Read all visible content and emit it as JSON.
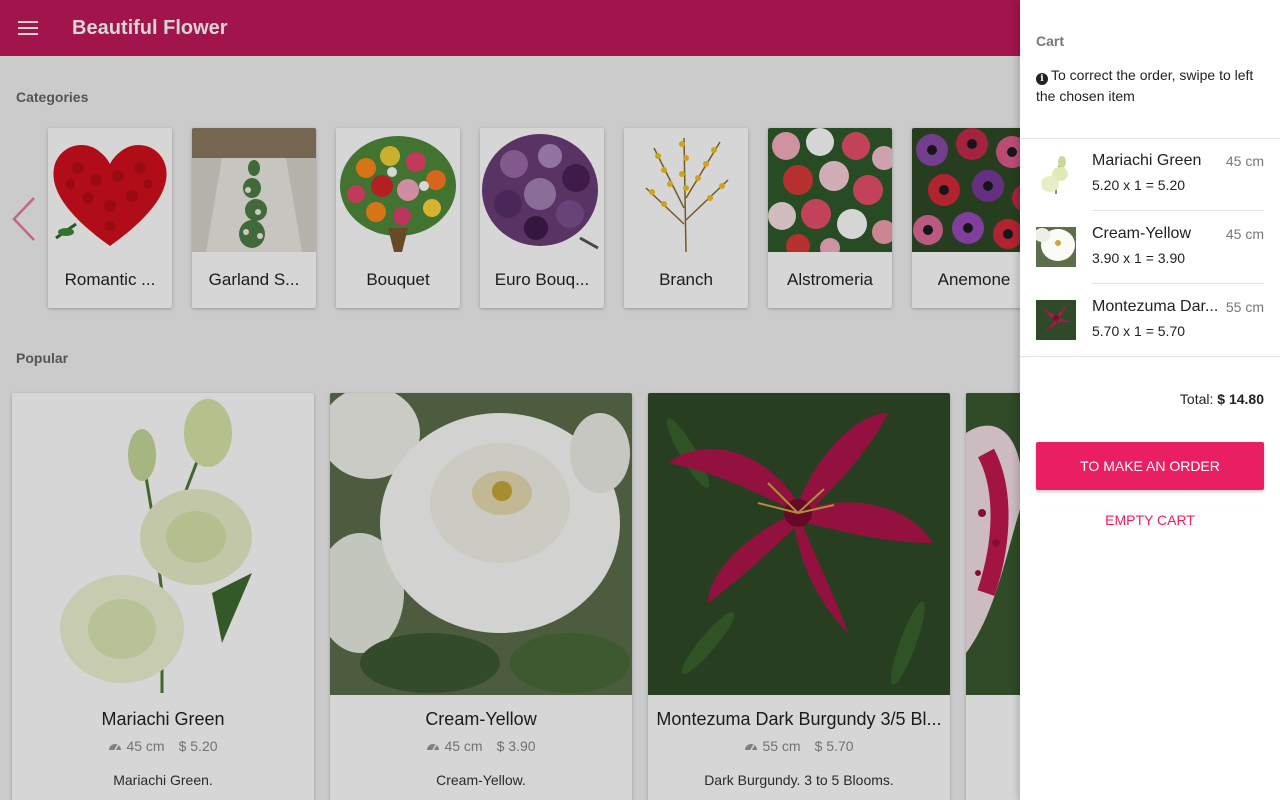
{
  "app": {
    "title": "Beautiful Flower"
  },
  "categories": {
    "title": "Categories",
    "items": [
      {
        "label": "Romantic ...",
        "icon": "heart-roses-image"
      },
      {
        "label": "Garland S...",
        "icon": "garland-table-image"
      },
      {
        "label": "Bouquet",
        "icon": "bouquet-image"
      },
      {
        "label": "Euro Bouq...",
        "icon": "euro-bouquet-image"
      },
      {
        "label": "Branch",
        "icon": "branch-image"
      },
      {
        "label": "Alstromeria",
        "icon": "alstromeria-image"
      },
      {
        "label": "Anemone",
        "icon": "anemone-image"
      }
    ]
  },
  "popular": {
    "title": "Popular",
    "items": [
      {
        "name": "Mariachi Green",
        "size": "45 cm",
        "price": "$ 5.20",
        "desc": "Mariachi Green."
      },
      {
        "name": "Cream-Yellow",
        "size": "45 cm",
        "price": "$ 3.90",
        "desc": "Cream-Yellow."
      },
      {
        "name": "Montezuma Dark Burgundy 3/5 Bl...",
        "size": "55 cm",
        "price": "$ 5.70",
        "desc": "Dark Burgundy. 3 to 5 Blooms."
      },
      {
        "name": "",
        "size": "",
        "price": "",
        "desc": ""
      }
    ]
  },
  "cart": {
    "title": "Cart",
    "hint": "To correct the order, swipe to left the chosen item",
    "items": [
      {
        "name": "Mariachi Green",
        "size": "45 cm",
        "calc": "5.20 x 1 = 5.20"
      },
      {
        "name": "Cream-Yellow",
        "size": "45 cm",
        "calc": "3.90 x 1 = 3.90"
      },
      {
        "name": "Montezuma Dar...",
        "size": "55 cm",
        "calc": "5.70 x 1 = 5.70"
      }
    ],
    "total_label": "Total:",
    "total_value": "$ 14.80",
    "order_label": "TO MAKE AN ORDER",
    "empty_label": "EMPTY CART"
  },
  "colors": {
    "primary": "#c2185b",
    "accent": "#e91e63"
  }
}
